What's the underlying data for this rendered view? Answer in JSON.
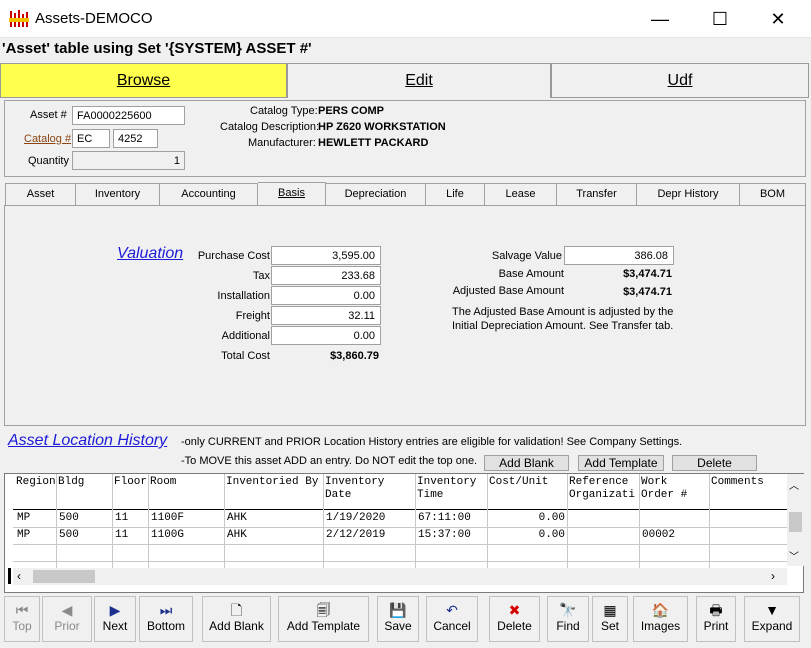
{
  "window": {
    "title": "Assets-DEMOCO",
    "minimize": "—",
    "maximize": "☐",
    "close": "✕"
  },
  "subtitle": "'Asset' table using Set '{SYSTEM} ASSET #'",
  "top_tabs": [
    {
      "label": "Browse"
    },
    {
      "label": "Edit"
    },
    {
      "label": "Udf"
    }
  ],
  "header": {
    "asset_label": "Asset #",
    "asset_value": "FA0000225600",
    "catalog_label": "Catalog #",
    "catalog_code": "EC",
    "catalog_num": "4252",
    "quantity_label": "Quantity",
    "quantity_value": "1",
    "catalog_type_label": "Catalog Type:",
    "catalog_type_value": "PERS COMP",
    "catalog_desc_label": "Catalog Description:",
    "catalog_desc_value": "HP Z620 WORKSTATION",
    "manufacturer_label": "Manufacturer:",
    "manufacturer_value": "HEWLETT PACKARD"
  },
  "sub_tabs": [
    "Asset",
    "Inventory",
    "Accounting",
    "Basis",
    "Depreciation",
    "Life",
    "Lease",
    "Transfer",
    "Depr History",
    "BOM"
  ],
  "valuation": {
    "title": "Valuation",
    "purchase_cost_label": "Purchase Cost",
    "purchase_cost": "3,595.00",
    "tax_label": "Tax",
    "tax": "233.68",
    "installation_label": "Installation",
    "installation": "0.00",
    "freight_label": "Freight",
    "freight": "32.11",
    "additional_label": "Additional",
    "additional": "0.00",
    "total_label": "Total Cost",
    "total": "$3,860.79",
    "salvage_label": "Salvage Value",
    "salvage": "386.08",
    "base_label": "Base Amount",
    "base": "$3,474.71",
    "adj_base_label": "Adjusted Base Amount",
    "adj_base": "$3,474.71",
    "note_line1": "The Adjusted Base Amount is adjusted by the",
    "note_line2": "Initial Depreciation Amount. See Transfer tab."
  },
  "history": {
    "title": "Asset Location History",
    "note1": "-only CURRENT and PRIOR Location History entries are eligible for validation! See Company Settings.",
    "note2": "-To MOVE this asset ADD an entry. Do NOT edit the top one.",
    "add_blank": "Add Blank",
    "add_template": "Add Template",
    "delete": "Delete",
    "headers": [
      "Region",
      "Bldg",
      "Floor",
      "Room",
      "Inventoried By",
      "Inventory\nDate",
      "Inventory\nTime",
      "Cost/Unit",
      "Reference\nOrganizati",
      "Work\nOrder #",
      "Comments"
    ],
    "rows": [
      [
        "MP",
        "500",
        "11",
        "1100F",
        "AHK",
        "1/19/2020",
        "67:11:00",
        "0.00",
        "",
        "",
        ""
      ],
      [
        "MP",
        "500",
        "11",
        "1100G",
        "AHK",
        "2/12/2019",
        "15:37:00",
        "0.00",
        "",
        "00002",
        ""
      ]
    ]
  },
  "toolbar": [
    {
      "label": "Top",
      "icon": "⏮",
      "enabled": false
    },
    {
      "label": "Prior",
      "icon": "◀",
      "enabled": false
    },
    {
      "label": "Next",
      "icon": "▶",
      "enabled": true
    },
    {
      "label": "Bottom",
      "icon": "⏭",
      "enabled": true
    },
    {
      "label": "Add Blank",
      "icon": "🗋",
      "enabled": true
    },
    {
      "label": "Add Template",
      "icon": "🗐",
      "enabled": true
    },
    {
      "label": "Save",
      "icon": "💾",
      "enabled": true
    },
    {
      "label": "Cancel",
      "icon": "↶",
      "enabled": true
    },
    {
      "label": "Delete",
      "icon": "✖",
      "enabled": true
    },
    {
      "label": "Find",
      "icon": "🔭",
      "enabled": true
    },
    {
      "label": "Set",
      "icon": "▦",
      "enabled": true
    },
    {
      "label": "Images",
      "icon": "🏠",
      "enabled": true
    },
    {
      "label": "Print",
      "icon": "🖶",
      "enabled": true
    },
    {
      "label": "Expand",
      "icon": "▼",
      "enabled": true
    }
  ],
  "colors": {
    "browse_tab": "#ffff4d",
    "link": "#1b1bd8",
    "delete_icon": "#d40000",
    "nav_icon": "#1c2f8c"
  }
}
